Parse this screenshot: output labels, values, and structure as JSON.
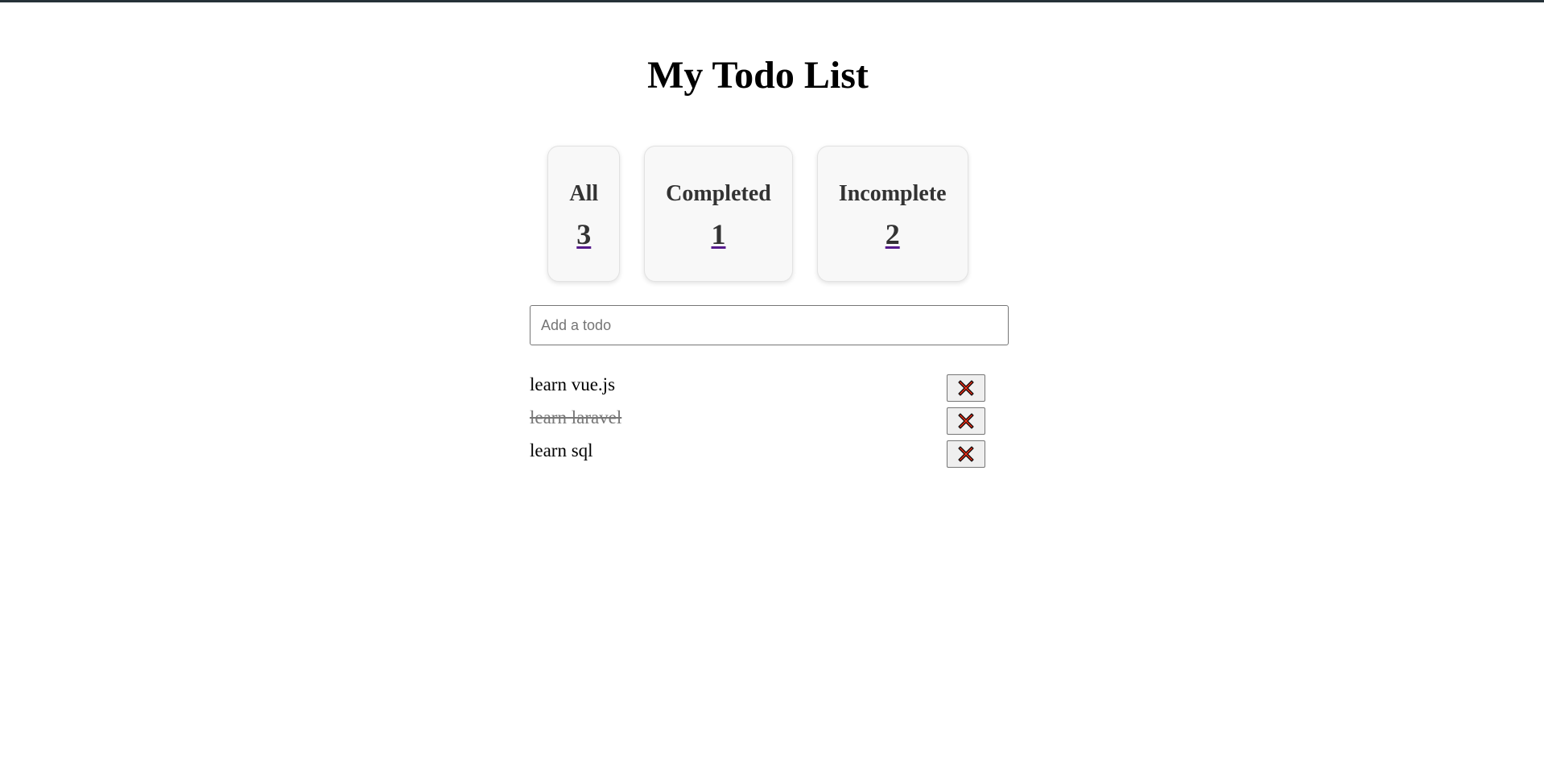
{
  "page": {
    "title": "My Todo List"
  },
  "stats": [
    {
      "label": "All",
      "count": "3"
    },
    {
      "label": "Completed",
      "count": "1"
    },
    {
      "label": "Incomplete",
      "count": "2"
    }
  ],
  "input": {
    "placeholder": "Add a todo",
    "value": ""
  },
  "todos": [
    {
      "text": "learn vue.js",
      "completed": false,
      "delete_icon": "cross-mark-icon"
    },
    {
      "text": "learn laravel",
      "completed": true,
      "delete_icon": "cross-mark-icon"
    },
    {
      "text": "learn sql",
      "completed": false,
      "delete_icon": "cross-mark-icon"
    }
  ],
  "colors": {
    "delete_icon_fill": "#dd2e1a",
    "completed_text": "#777777",
    "count_underline": "#551a8b"
  }
}
